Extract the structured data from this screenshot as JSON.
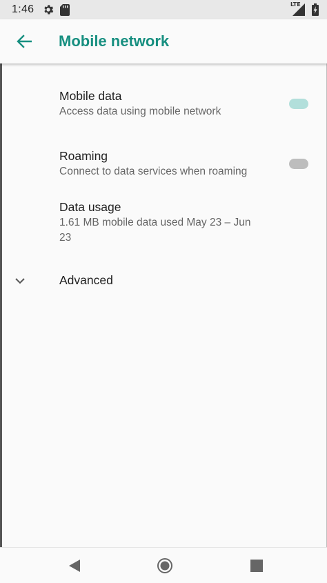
{
  "status_bar": {
    "time": "1:46",
    "network_label": "LTE",
    "icons": [
      "settings-gear-icon",
      "sd-card-icon",
      "lte-signal-icon",
      "battery-icon"
    ]
  },
  "app_bar": {
    "back_icon": "arrow-left-icon",
    "title": "Mobile network"
  },
  "preferences": [
    {
      "title": "Mobile data",
      "summary": "Access data using mobile network",
      "toggle": "on"
    },
    {
      "title": "Roaming",
      "summary": "Connect to data services when roaming",
      "toggle": "off"
    },
    {
      "title": "Data usage",
      "summary": "1.61 MB mobile data used May 23 – Jun 23"
    }
  ],
  "advanced": {
    "label": "Advanced",
    "icon": "chevron-down-icon"
  },
  "nav_bar": {
    "icons": [
      "back-triangle-icon",
      "home-circle-icon",
      "recents-square-icon"
    ]
  },
  "colors": {
    "accent": "#178f80",
    "toggle_on_track": "#b2dfdb",
    "toggle_off_track": "#bdbdbd",
    "status_bar_bg": "#e8e8e8",
    "background": "#fafafa"
  }
}
